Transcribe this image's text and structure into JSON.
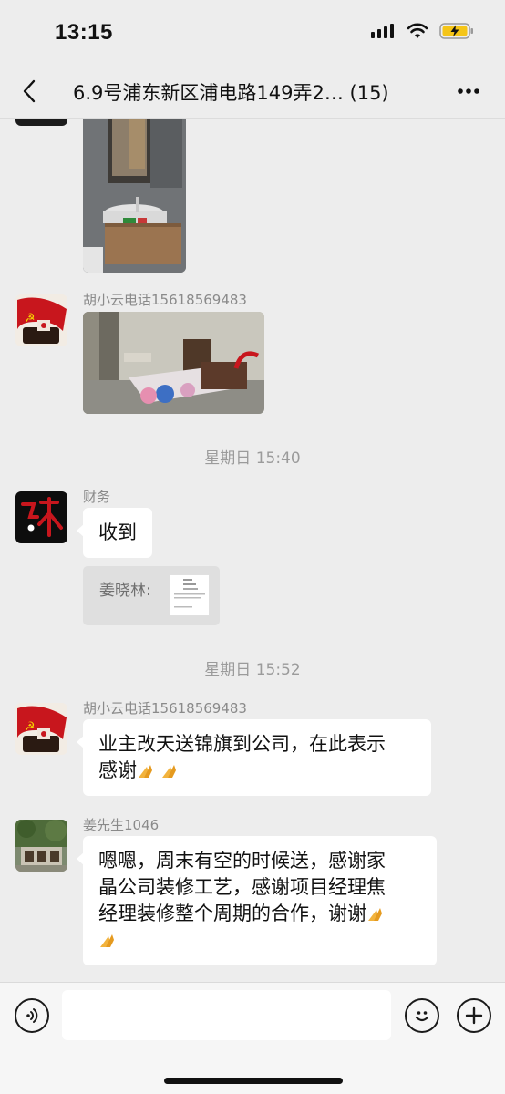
{
  "status_bar": {
    "time": "13:15"
  },
  "header": {
    "title": "6.9号浦东新区浦电路149弄2… (15)"
  },
  "messages": [
    {
      "sender": "胡小云电话15618569483"
    },
    {
      "timestamp": "星期日 15:40"
    },
    {
      "sender": "财务",
      "text": "收到",
      "quote_name": "姜晓林:"
    },
    {
      "timestamp": "星期日 15:52"
    },
    {
      "sender": "胡小云电话15618569483",
      "text_line1": "业主改天送锦旗到公司，在此表示",
      "text_line2": "感谢"
    },
    {
      "sender": "姜先生1046",
      "text_line1": "嗯嗯，周末有空的时候送，感谢家",
      "text_line2": "晶公司装修工艺，感谢项目经理焦",
      "text_line3": "经理装修整个周期的合作，谢谢"
    }
  ],
  "icons": {
    "back": "chevron-left-icon",
    "more": "more-dots-icon",
    "voice": "voice-icon",
    "emoji": "emoji-icon",
    "add": "plus-icon",
    "pray": "folded-hands-emoji"
  },
  "colors": {
    "background": "#ededed",
    "bubble": "#ffffff",
    "meta_text": "#8a8a8a",
    "party_red": "#c8161d"
  }
}
